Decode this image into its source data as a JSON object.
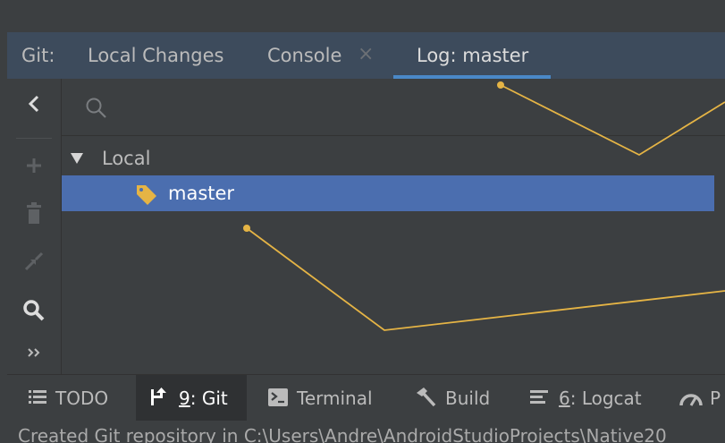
{
  "tool_window": {
    "tabs_label": "Git:",
    "tabs": [
      {
        "label": "Local Changes"
      },
      {
        "label": "Console",
        "close": "×"
      },
      {
        "label": "Log: master"
      }
    ]
  },
  "branches": {
    "search_placeholder": "",
    "group_label": "Local",
    "items": [
      {
        "label": "master"
      }
    ]
  },
  "bottom_tabs": [
    {
      "label": "TODO"
    },
    {
      "mnemonic": "9",
      "rest": ": Git"
    },
    {
      "label": "Terminal"
    },
    {
      "label": "Build"
    },
    {
      "mnemonic": "6",
      "rest": ": Logcat"
    },
    {
      "label": "P"
    }
  ],
  "status": {
    "message": "Created Git repository in C:\\Users\\Andre\\AndroidStudioProjects\\Native20"
  },
  "colors": {
    "accent": "#4a88c7",
    "selection": "#4b6eaf",
    "callout": "#e5b445"
  }
}
